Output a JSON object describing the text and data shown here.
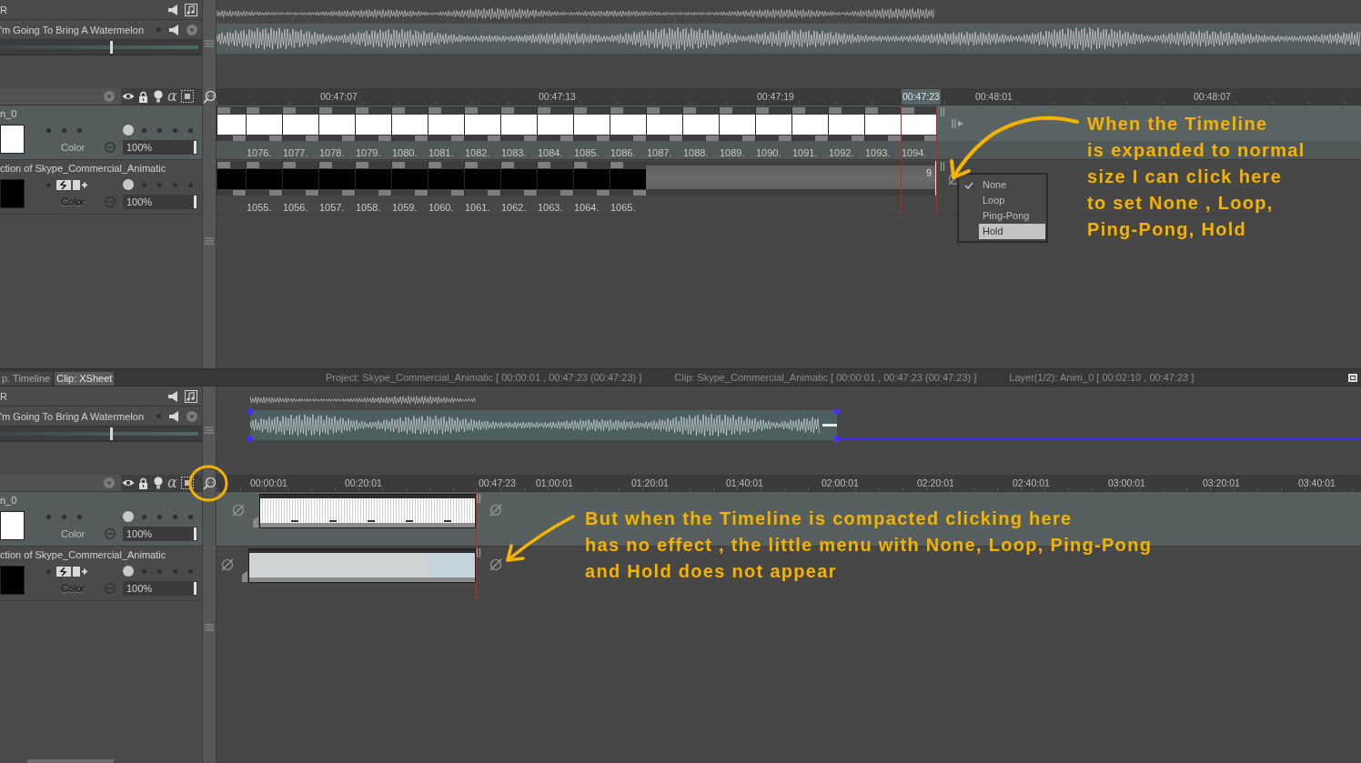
{
  "expanded_view": {
    "sound_header": {
      "title": "R",
      "track_name": "'m Going To Bring A Watermelon",
      "volume": {
        "level": 0.56
      }
    },
    "layer_header": {
      "alpha_label": "α"
    },
    "ruler": [
      {
        "label": "00:47:07",
        "current": false
      },
      {
        "label": "00:47:13",
        "current": false
      },
      {
        "label": "00:47:19",
        "current": false
      },
      {
        "label": "00:47:23",
        "current": true
      },
      {
        "label": "00:48:01",
        "current": false
      },
      {
        "label": "00:48:07",
        "current": false
      }
    ],
    "layers": [
      {
        "name": "n_0",
        "kind": "plain",
        "selected": true,
        "color": "#ffffff",
        "filter": {
          "label": "Color",
          "disabled": false
        },
        "opacity": {
          "value": "100%",
          "level": 1
        },
        "frames": [
          "1076.",
          "1077.",
          "1078.",
          "1079.",
          "1080.",
          "1081.",
          "1082.",
          "1083.",
          "1084.",
          "1085.",
          "1086.",
          "1087.",
          "1088.",
          "1089.",
          "1090.",
          "1091.",
          "1092.",
          "1093.",
          "1094."
        ]
      },
      {
        "name": "ction of Skype_Commercial_Animatic",
        "kind": "toggles",
        "selected": false,
        "color": "#000000",
        "filter": {
          "label": "Color",
          "disabled": true
        },
        "opacity": {
          "value": "100%",
          "level": 1
        },
        "frames": [
          "1055.",
          "1056.",
          "1057.",
          "1058.",
          "1059.",
          "1060.",
          "1061.",
          "1062.",
          "1063.",
          "1064.",
          "1065."
        ],
        "hold_label": "9"
      }
    ],
    "loop_menu": [
      {
        "label": "None",
        "checked": true,
        "selected": false
      },
      {
        "label": "Loop",
        "checked": false,
        "selected": false
      },
      {
        "label": "Ping-Pong",
        "checked": false,
        "selected": false
      },
      {
        "label": "Hold",
        "checked": false,
        "selected": true
      }
    ]
  },
  "status_bar": {
    "tabs": [
      {
        "label": "p. Timeline",
        "selected": false
      },
      {
        "label": "Clip: XSheet",
        "selected": true
      }
    ],
    "info": [
      "Project: Skype_Commercial_Animatic [ 00:00:01 , 00:47:23 (00:47:23) ]",
      "Clip: Skype_Commercial_Animatic [ 00:00:01 , 00:47:23 (00:47:23) ]",
      "Layer(1/2): Anim_0 [ 00:02:10 , 00:47:23 ]"
    ]
  },
  "compact_view": {
    "sound_header": {
      "title": "R",
      "track_name": "'m Going To Bring A Watermelon",
      "volume": {
        "level": 0.56
      }
    },
    "layer_header": {
      "alpha_label": "α"
    },
    "ruler": [
      {
        "label": "00:00:01",
        "current": false
      },
      {
        "label": "00:20:01",
        "current": false
      },
      {
        "label": "00:47:23",
        "current": false
      },
      {
        "label": "01:00:01",
        "current": false
      },
      {
        "label": "01:20:01",
        "current": false
      },
      {
        "label": "01:40:01",
        "current": false
      },
      {
        "label": "02:00:01",
        "current": false
      },
      {
        "label": "02:20:01",
        "current": false
      },
      {
        "label": "02:40:01",
        "current": false
      },
      {
        "label": "03:00:01",
        "current": false
      },
      {
        "label": "03:20:01",
        "current": false
      },
      {
        "label": "03:40:01",
        "current": false
      }
    ],
    "layers": [
      {
        "name": "n_0",
        "kind": "plain",
        "selected": true,
        "color": "#ffffff",
        "filter": {
          "label": "Color",
          "disabled": false
        },
        "opacity": {
          "value": "100%",
          "level": 1
        },
        "clip": {
          "kind": "frames"
        }
      },
      {
        "name": "ction of Skype_Commercial_Animatic",
        "kind": "toggles",
        "selected": false,
        "color": "#000000",
        "filter": {
          "label": "Color",
          "disabled": true
        },
        "opacity": {
          "value": "100%",
          "level": 1
        },
        "clip": {
          "kind": "picture"
        }
      }
    ]
  },
  "annotations": [
    {
      "text": "When the Timeline\nis expanded to normal\nsize I can click here\nto set None , Loop,\nPing-Pong, Hold"
    },
    {
      "text": "But when the Timeline is compacted clicking here\nhas no effect , the little menu with None, Loop, Ping-Pong\nand Hold does not appear"
    }
  ]
}
